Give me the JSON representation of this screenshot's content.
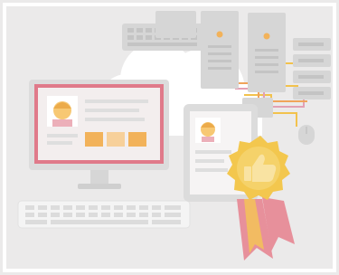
{
  "colors": {
    "background": "#ebeaea",
    "frame": "#ffffff",
    "cloud": "#ffffff",
    "server": "#d6d6d6",
    "server_dark": "#c4c4c4",
    "monitor_bezel": "#dcdcdc",
    "screen_border": "#e07a8a",
    "screen_fill": "#f3eeee",
    "avatar_face": "#f7c873",
    "avatar_hair": "#ecab4a",
    "tile_orange": "#f2b25a",
    "tile_peach": "#f7d09a",
    "badge_gold": "#f3c74e",
    "badge_inner": "#f7d978",
    "ribbon_pink": "#e7909b",
    "ribbon_orange": "#f2bb62",
    "cable_yellow": "#f2c24d",
    "cable_pink": "#e3a0b4",
    "cable_orange": "#f0a45a",
    "keyboard": "#f2f2f2",
    "key": "#dcdcdc"
  },
  "icons": [
    "cloud-icon",
    "server-rack-icon",
    "monitor-icon",
    "keyboard-icon",
    "tablet-icon",
    "thumbs-up-badge-icon",
    "mouse-icon",
    "user-avatar-icon"
  ]
}
